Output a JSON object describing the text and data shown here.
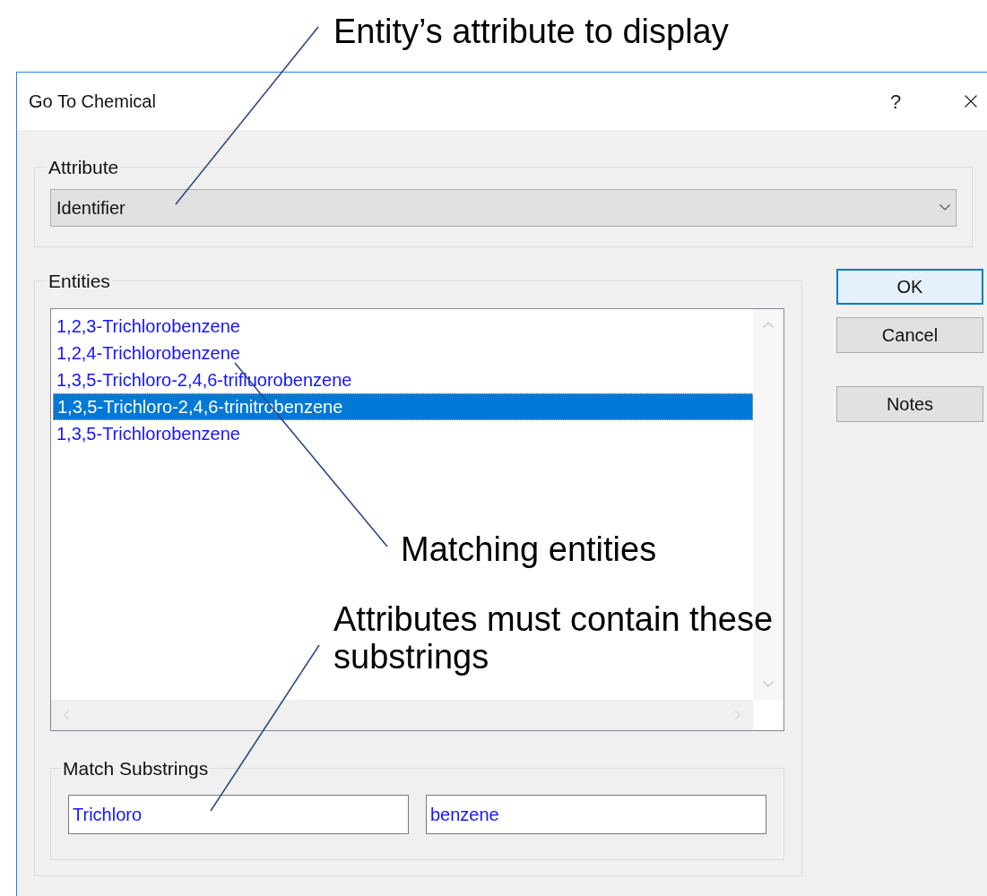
{
  "annotations": [
    {
      "text": "Entity’s attribute to display"
    },
    {
      "text": "Matching entities"
    },
    {
      "text": "Attributes must contain these substrings"
    }
  ],
  "dialog": {
    "title": "Go To Chemical",
    "help": "?"
  },
  "attribute": {
    "label": "Attribute",
    "value": "Identifier"
  },
  "entities": {
    "label": "Entities",
    "items": [
      {
        "label": "1,2,3-Trichlorobenzene",
        "selected": false
      },
      {
        "label": "1,2,4-Trichlorobenzene",
        "selected": false
      },
      {
        "label": "1,3,5-Trichloro-2,4,6-trifluorobenzene",
        "selected": false
      },
      {
        "label": "1,3,5-Trichloro-2,4,6-trinitrobenzene",
        "selected": true
      },
      {
        "label": "1,3,5-Trichlorobenzene",
        "selected": false
      }
    ]
  },
  "match_substrings": {
    "label": "Match Substrings",
    "fields": [
      {
        "value": "Trichloro"
      },
      {
        "value": "benzene"
      }
    ]
  },
  "buttons": [
    {
      "label": "OK",
      "focused": true
    },
    {
      "label": "Cancel",
      "focused": false
    },
    {
      "label": "Notes",
      "focused": false
    }
  ]
}
